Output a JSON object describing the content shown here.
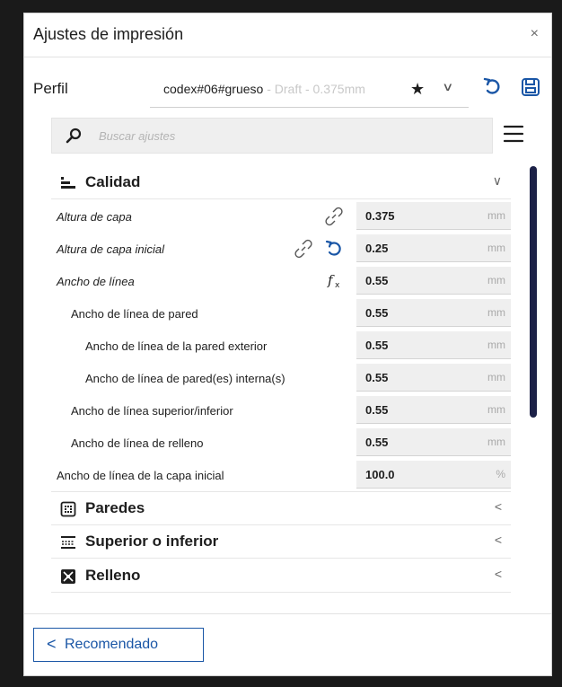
{
  "window": {
    "title": "Ajustes de impresión",
    "close_glyph": "×"
  },
  "profile": {
    "label": "Perfil",
    "name": "codex#06#grueso",
    "suffix": " - Draft - 0.375mm"
  },
  "search": {
    "placeholder": "Buscar ajustes"
  },
  "sections": {
    "calidad": {
      "label": "Calidad",
      "icon": "quality-icon",
      "expanded": true
    },
    "paredes": {
      "label": "Paredes",
      "icon": "walls-icon"
    },
    "superior": {
      "label": "Superior o inferior",
      "icon": "top-bottom-icon"
    },
    "relleno": {
      "label": "Relleno",
      "icon": "infill-icon"
    }
  },
  "settings": [
    {
      "label": "Altura de capa",
      "value": "0.375",
      "unit": "mm",
      "icons": [
        "link-icon"
      ]
    },
    {
      "label": "Altura de capa inicial",
      "value": "0.25",
      "unit": "mm",
      "icons": [
        "link-icon",
        "reset-icon"
      ]
    },
    {
      "label": "Ancho de línea",
      "value": "0.55",
      "unit": "mm",
      "icons": [
        "function-icon"
      ]
    },
    {
      "label": "Ancho de línea de pared",
      "value": "0.55",
      "unit": "mm"
    },
    {
      "label": "Ancho de línea de la pared exterior",
      "value": "0.55",
      "unit": "mm"
    },
    {
      "label": "Ancho de línea de pared(es) interna(s)",
      "value": "0.55",
      "unit": "mm"
    },
    {
      "label": "Ancho de línea superior/inferior",
      "value": "0.55",
      "unit": "mm"
    },
    {
      "label": "Ancho de línea de relleno",
      "value": "0.55",
      "unit": "mm"
    },
    {
      "label": "Ancho de línea de la capa inicial",
      "value": "100.0",
      "unit": "%"
    }
  ],
  "footer": {
    "recommended_label": "Recomendado"
  },
  "colors": {
    "accent": "#1a56a6",
    "scrollbar": "#1c2147"
  }
}
